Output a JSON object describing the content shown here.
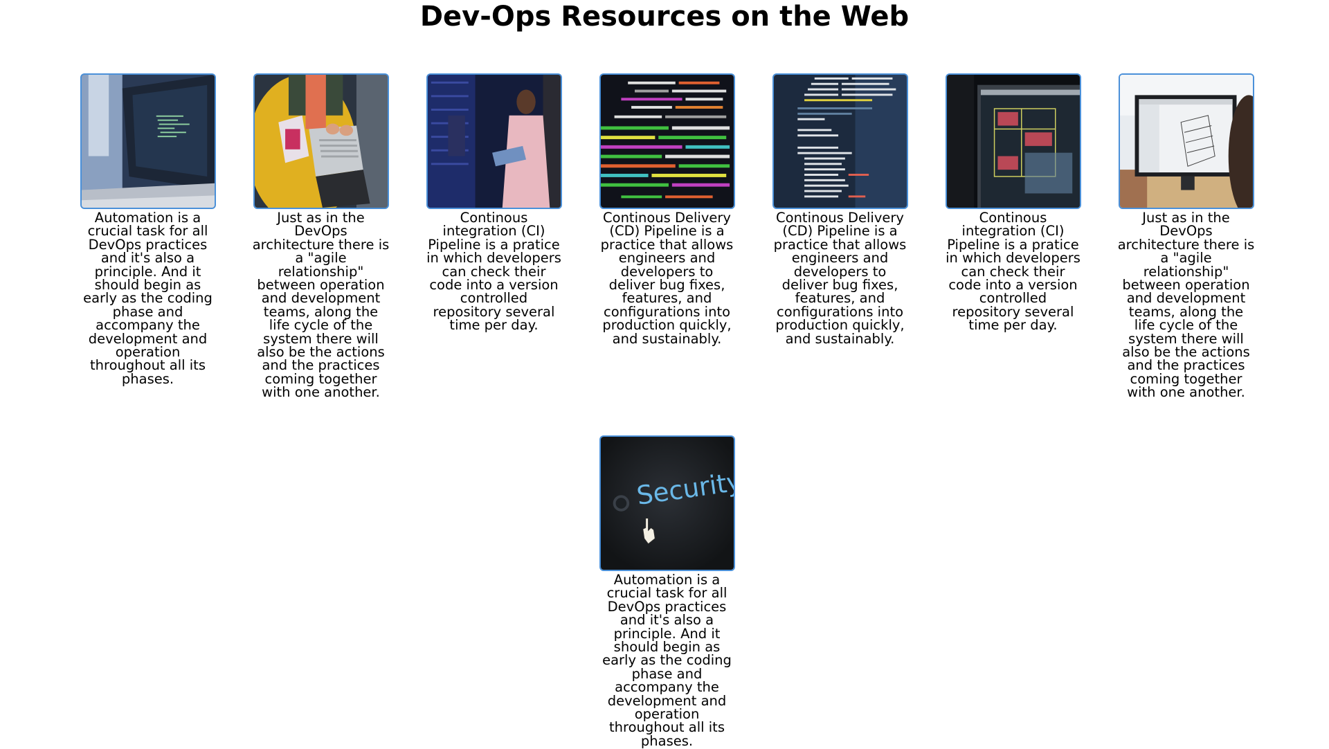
{
  "page": {
    "title": "Dev-Ops Resources on the Web"
  },
  "accent_color": "#4a90d9",
  "cards": [
    {
      "image": "laptop-code-photo",
      "caption": "Automation is a crucial task for all DevOps practices and it's also a principle. And it should begin as early as the coding phase and accompany the development and operation throughout all its phases."
    },
    {
      "image": "typing-laptop-photo",
      "caption": "Just as in the DevOps architecture there is a \"agile relationship\" between operation and development teams, along the life cycle of the system there will also be the actions and the practices coming together with one another."
    },
    {
      "image": "server-room-woman-photo",
      "caption": "Continous integration (CI) Pipeline is a pratice in which developers can check their code into a version controlled repository several time per day."
    },
    {
      "image": "colorful-code-screen-photo",
      "caption": "Continous Delivery (CD) Pipeline is a practice that allows engineers and developers to deliver bug fixes, features, and configurations into production quickly, and sustainably."
    },
    {
      "image": "code-editor-photo",
      "caption": "Continous Delivery (CD) Pipeline is a practice that allows engineers and developers to deliver bug fixes, features, and configurations into production quickly, and sustainably."
    },
    {
      "image": "cad-monitor-photo",
      "caption": "Continous integration (CI) Pipeline is a pratice in which developers can check their code into a version controlled repository several time per day."
    },
    {
      "image": "engineering-monitor-photo",
      "caption": "Just as in the DevOps architecture there is a \"agile relationship\" between operation and development teams, along the life cycle of the system there will also be the actions and the practices coming together with one another."
    },
    {
      "image": "security-screen-photo",
      "image_text": "Security",
      "caption": "Automation is a crucial task for all DevOps practices and it's also a principle. And it should begin as early as the coding phase and accompany the development and operation throughout all its phases."
    }
  ]
}
